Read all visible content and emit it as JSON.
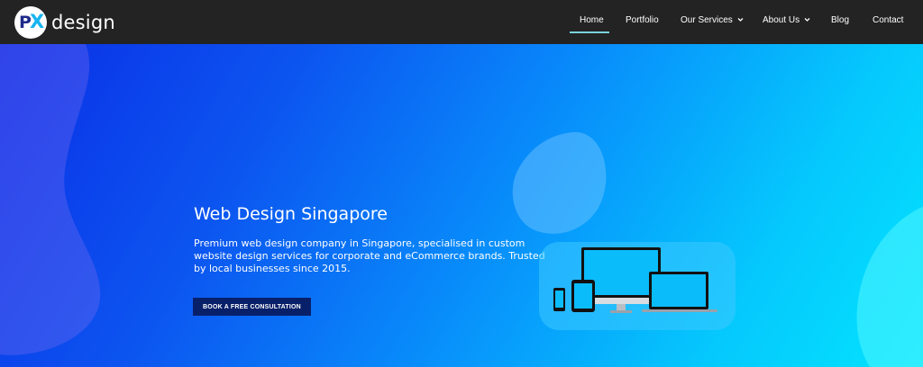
{
  "brand": {
    "logo_initials_p": "P",
    "logo_initials_x": "X",
    "wordmark": "design"
  },
  "nav": {
    "items": [
      {
        "label": "Home",
        "active": true
      },
      {
        "label": "Portfolio"
      },
      {
        "label": "Our Services",
        "has_dropdown": true
      },
      {
        "label": "About Us",
        "has_dropdown": true
      },
      {
        "label": "Blog"
      },
      {
        "label": "Contact"
      }
    ],
    "chevron_glyph": "⌄"
  },
  "hero": {
    "title": "Web Design Singapore",
    "description": "Premium web design company in Singapore, specialised in custom website design services for corporate and eCommerce brands. Trusted by local businesses since 2015.",
    "cta_label": "BOOK A FREE CONSULTATION",
    "illustration": "responsive-devices-icon"
  },
  "colors": {
    "navbar_bg": "#232323",
    "active_underline": "#7ad0da",
    "cta_bg": "#08206a",
    "gradient_start": "#0a2ee6",
    "gradient_end": "#04e4fe"
  }
}
